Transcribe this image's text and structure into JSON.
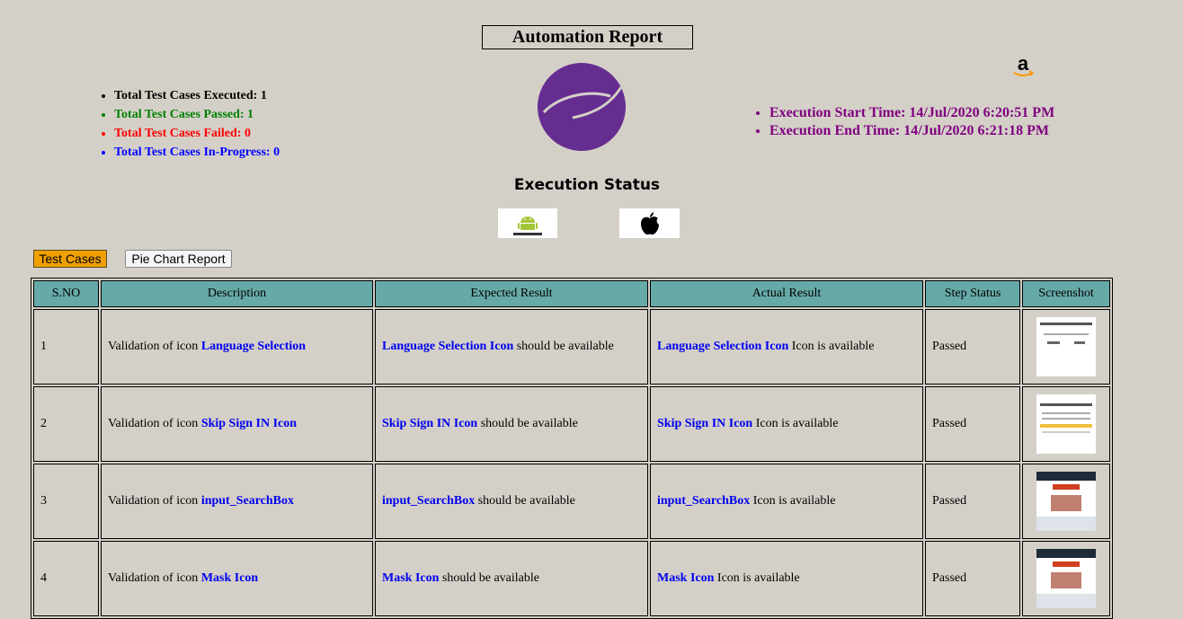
{
  "header": {
    "title": "Automation Report"
  },
  "summary": [
    {
      "label": "Total Test Cases Executed: 1",
      "color": "#000000"
    },
    {
      "label": "Total Test Cases Passed: 1",
      "color": "#008000"
    },
    {
      "label": "Total Test Cases Failed: 0",
      "color": "#ff0000"
    },
    {
      "label": "Total Test Cases In-Progress: 0",
      "color": "#0000ff"
    }
  ],
  "times": {
    "start": "Execution Start Time: 14/Jul/2020 6:20:51 PM",
    "end": "Execution End Time: 14/Jul/2020 6:21:18 PM"
  },
  "section": {
    "execution_status": "Execution Status"
  },
  "icons": {
    "logo": "app-logo-icon",
    "amazon": "amazon-icon",
    "android": "android-icon",
    "apple": "apple-icon"
  },
  "buttons": {
    "test_cases": "Test Cases",
    "pie_chart": "Pie Chart Report"
  },
  "table": {
    "headers": [
      "S.NO",
      "Description",
      "Expected Result",
      "Actual Result",
      "Step Status",
      "Screenshot"
    ],
    "desc_prefix": "Validation of icon ",
    "expected_suffix": " should be available",
    "actual_suffix": " Icon is available",
    "rows": [
      {
        "sno": "1",
        "element": "Language Selection",
        "expected_element": "Language Selection Icon",
        "actual_element": "Language Selection Icon",
        "status": "Passed"
      },
      {
        "sno": "2",
        "element": "Skip Sign IN Icon",
        "expected_element": "Skip Sign IN Icon",
        "actual_element": "Skip Sign IN Icon",
        "status": "Passed"
      },
      {
        "sno": "3",
        "element": "input_SearchBox",
        "expected_element": "input_SearchBox",
        "actual_element": "input_SearchBox",
        "status": "Passed"
      },
      {
        "sno": "4",
        "element": "Mask Icon",
        "expected_element": "Mask Icon",
        "actual_element": "Mask Icon",
        "status": "Passed"
      }
    ]
  }
}
